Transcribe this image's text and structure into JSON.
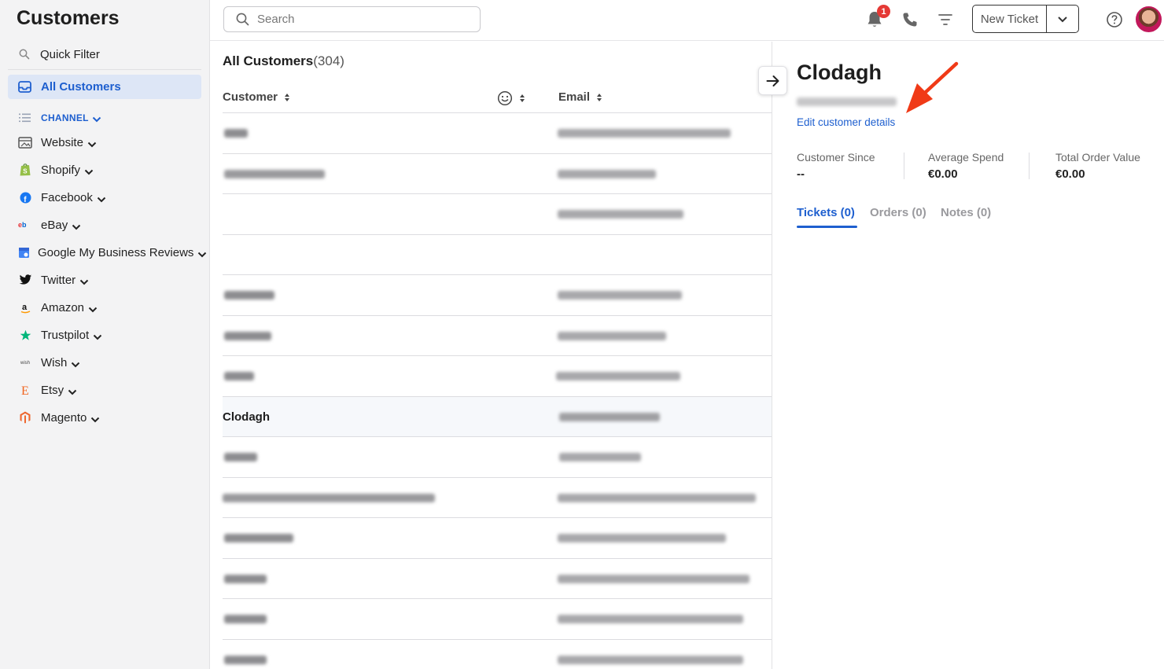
{
  "sidebar": {
    "title": "Customers",
    "quick_filter": "Quick Filter",
    "all_customers": "All Customers",
    "channel_header": "CHANNEL",
    "channels": [
      {
        "label": "Website",
        "icon": "website-icon"
      },
      {
        "label": "Shopify",
        "icon": "shopify-icon"
      },
      {
        "label": "Facebook",
        "icon": "facebook-icon"
      },
      {
        "label": "eBay",
        "icon": "ebay-icon"
      },
      {
        "label": "Google My Business Reviews",
        "icon": "google-my-business-icon"
      },
      {
        "label": "Twitter",
        "icon": "twitter-icon"
      },
      {
        "label": "Amazon",
        "icon": "amazon-icon"
      },
      {
        "label": "Trustpilot",
        "icon": "trustpilot-icon"
      },
      {
        "label": "Wish",
        "icon": "wish-icon"
      },
      {
        "label": "Etsy",
        "icon": "etsy-icon"
      },
      {
        "label": "Magento",
        "icon": "magento-icon"
      }
    ]
  },
  "topbar": {
    "search_placeholder": "Search",
    "notification_count": "1",
    "new_ticket_label": "New Ticket"
  },
  "list": {
    "title": "All Customers",
    "count": "(304)",
    "columns": {
      "customer": "Customer",
      "email": "Email"
    },
    "selected_customer": "Clodagh"
  },
  "detail": {
    "name": "Clodagh",
    "edit_link": "Edit customer details",
    "stats": [
      {
        "label": "Customer Since",
        "value": "--"
      },
      {
        "label": "Average Spend",
        "value": "€0.00"
      },
      {
        "label": "Total Order Value",
        "value": "€0.00"
      }
    ],
    "tabs": [
      "Tickets (0)",
      "Orders (0)",
      "Notes (0)"
    ]
  },
  "colors": {
    "accent": "#1e5fcf",
    "badge": "#e53935",
    "annotation_arrow": "#f03a17",
    "sidebar_bg": "#f3f3f4"
  }
}
